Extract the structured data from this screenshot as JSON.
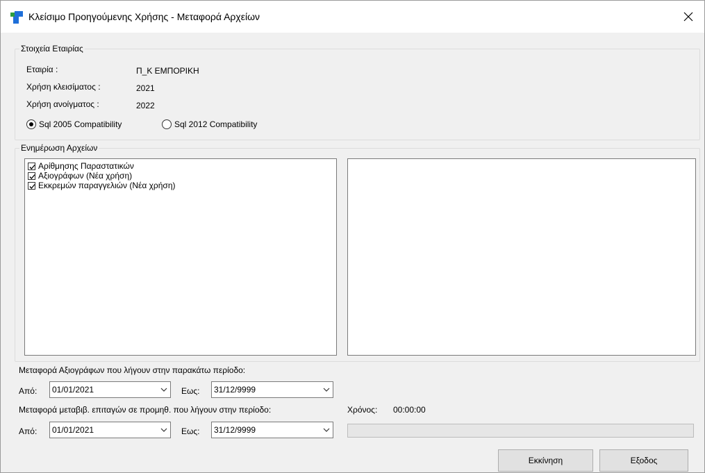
{
  "window": {
    "title": "Κλείσιμο Προηγούμενης Χρήσης - Μεταφορά Αρχείων",
    "close_symbol": "✕"
  },
  "company_group": {
    "legend": "Στοιχεία Εταιρίας",
    "company_label": "Εταιρία :",
    "company_value": "Π_Κ ΕΜΠΟΡΙΚΗ",
    "closing_year_label": "Χρήση κλεισίματος :",
    "closing_year_value": "2021",
    "opening_year_label": "Χρήση ανοίγματος :",
    "opening_year_value": "2022",
    "radio_options": [
      {
        "label": "Sql 2005 Compatibility",
        "checked": true
      },
      {
        "label": "Sql 2012 Compatibility",
        "checked": false
      }
    ]
  },
  "files_group": {
    "legend": "Ενημέρωση Αρχείων",
    "items": [
      {
        "label": "Αρίθμησης Παραστατικών",
        "checked": true
      },
      {
        "label": "Αξιογράφων (Νέα χρήση)",
        "checked": true
      },
      {
        "label": "Εκκρεμών παραγγελιών (Νέα χρήση)",
        "checked": true
      }
    ]
  },
  "transfer_securities": {
    "caption": "Μεταφορά Αξιογράφων που λήγουν στην παρακάτω περίοδο:",
    "from_label": "Από:",
    "from_value": "01/01/2021",
    "to_label": "Εως:",
    "to_value": "31/12/9999"
  },
  "transfer_checks": {
    "caption": "Μεταφορά μεταβιβ. επιταγών σε προμηθ. που λήγουν στην περίοδο:",
    "from_label": "Από:",
    "from_value": "01/01/2021",
    "to_label": "Εως:",
    "to_value": "31/12/9999"
  },
  "timer": {
    "label": "Χρόνος:",
    "value": "00:00:00"
  },
  "progress": {
    "value": 0
  },
  "buttons": {
    "start_label": "Εκκίνηση",
    "exit_label": "Εξοδος"
  },
  "colors": {
    "icon_blue": "#1e6fd9",
    "icon_green": "#2e9e3e",
    "window_bg": "#f0f0f0"
  }
}
